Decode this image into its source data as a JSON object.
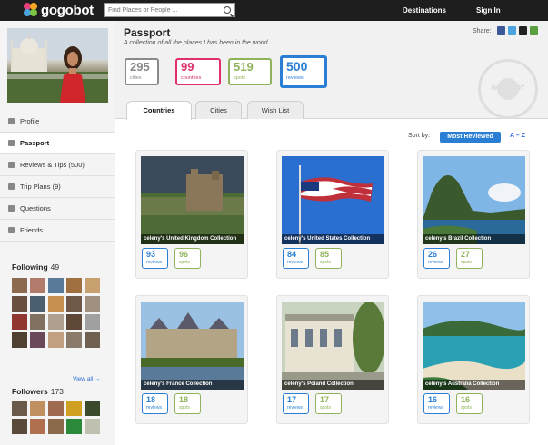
{
  "brand": {
    "name": "gogobot"
  },
  "search": {
    "placeholder": "Find Places or People ..."
  },
  "topnav": {
    "destinations": "Destinations",
    "signin": "Sign In"
  },
  "sidebar": {
    "nav": [
      {
        "label": "Profile",
        "icon": "person-icon"
      },
      {
        "label": "Passport",
        "icon": "passport-icon",
        "active": true
      },
      {
        "label": "Reviews & Tips (500)",
        "icon": "pencil-icon"
      },
      {
        "label": "Trip Plans (9)",
        "icon": "map-icon"
      },
      {
        "label": "Questions",
        "icon": "speech-bubble-icon"
      },
      {
        "label": "Friends",
        "icon": "arrows-icon"
      }
    ],
    "following": {
      "label": "Following",
      "count": "49"
    },
    "view_all": "View all →",
    "followers": {
      "label": "Followers",
      "count": "173"
    }
  },
  "page": {
    "title": "Passport",
    "subtitle": "A collection of all the places I has been in the world.",
    "share_label": "Share:",
    "stats": [
      {
        "value": "295",
        "label": "cities",
        "color": "#8a8a8a"
      },
      {
        "value": "99",
        "label": "countries",
        "color": "#e0306a"
      },
      {
        "value": "519",
        "label": "spots",
        "color": "#8fb35a"
      },
      {
        "value": "500",
        "label": "reviews",
        "color": "#2a7fd4"
      }
    ],
    "stamp_text": "GOGOBOT",
    "tabs": [
      {
        "label": "Countries",
        "active": true
      },
      {
        "label": "Cities"
      },
      {
        "label": "Wish List"
      }
    ],
    "sort_label": "Sort by:",
    "sort_active": "Most Reviewed",
    "sort_alt": "A – Z"
  },
  "collections": [
    {
      "caption": "celeny's United Kingdom Collection",
      "reviews": "93",
      "spots": "96"
    },
    {
      "caption": "celeny's United States Collection",
      "reviews": "84",
      "spots": "85"
    },
    {
      "caption": "celeny's Brazil Collection",
      "reviews": "26",
      "spots": "27"
    },
    {
      "caption": "celeny's France Collection",
      "reviews": "18",
      "spots": "18"
    },
    {
      "caption": "celeny's Poland Collection",
      "reviews": "17",
      "spots": "17"
    },
    {
      "caption": "celeny's Australia Collection",
      "reviews": "16",
      "spots": "16"
    }
  ],
  "labels": {
    "reviews": "reviews",
    "spots": "spots"
  }
}
